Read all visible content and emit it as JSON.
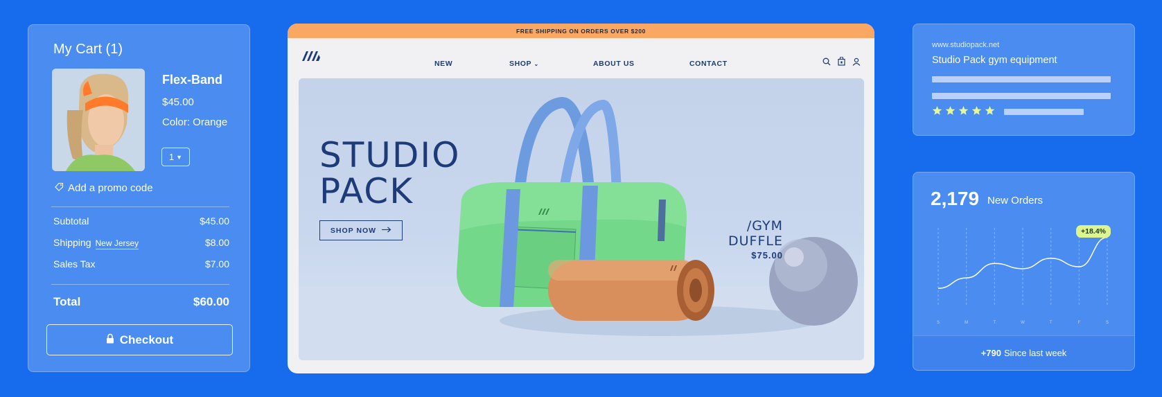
{
  "cart": {
    "title": "My Cart (1)",
    "product": {
      "name": "Flex-Band",
      "price": "$45.00",
      "color": "Color: Orange",
      "quantity": "1"
    },
    "promo": "Add a promo code",
    "subtotal": {
      "label": "Subtotal",
      "value": "$45.00"
    },
    "shipping": {
      "label": "Shipping",
      "state": "New Jersey",
      "value": "$8.00"
    },
    "tax": {
      "label": "Sales Tax",
      "value": "$7.00"
    },
    "total": {
      "label": "Total",
      "value": "$60.00"
    },
    "checkout_label": "Checkout"
  },
  "site": {
    "banner": "FREE SHIPPING ON ORDERS OVER $200",
    "nav": {
      "new": "NEW",
      "shop": "SHOP",
      "about": "ABOUT US",
      "contact": "CONTACT"
    },
    "hero": {
      "title_line1": "STUDIO",
      "title_line2": "PACK",
      "cta": "SHOP NOW",
      "product_line1": "/GYM",
      "product_line2": "DUFFLE",
      "product_price": "$75.00"
    },
    "colors": {
      "banner": "#f9a763",
      "brand": "#1c3b78"
    }
  },
  "seo": {
    "url": "www.studiopack.net",
    "title": "Studio Pack gym equipment",
    "stars": 5
  },
  "orders": {
    "count": "2,179",
    "label": "New Orders",
    "badge": "+18.4%",
    "footer_bold": "+790",
    "footer_text": "Since last week"
  },
  "chart_data": {
    "type": "line",
    "categories": [
      "S",
      "M",
      "T",
      "W",
      "T",
      "F",
      "S"
    ],
    "series": [
      {
        "values": [
          22,
          38,
          60,
          52,
          68,
          55,
          100
        ]
      }
    ],
    "ylim": [
      0,
      110
    ],
    "grid": true
  }
}
